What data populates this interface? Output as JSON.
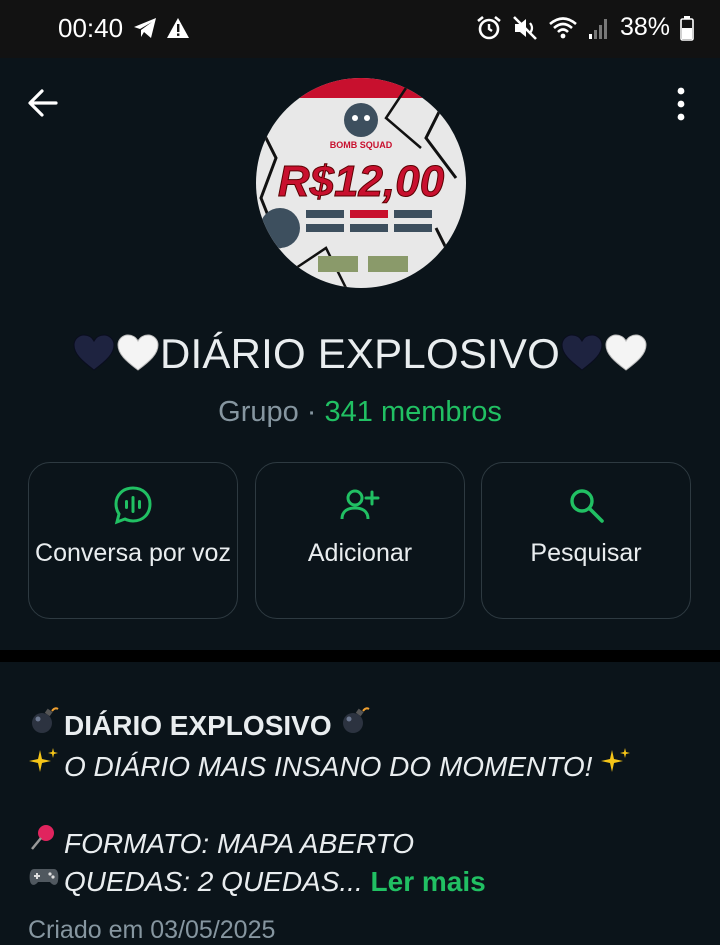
{
  "status_bar": {
    "time": "00:40",
    "battery": "38%",
    "icons": [
      "telegram-icon",
      "warning-icon",
      "alarm-icon",
      "mute-icon",
      "wifi-icon",
      "signal-icon",
      "battery-icon"
    ]
  },
  "header": {
    "back_icon": "arrow-left-icon",
    "menu_icon": "more-vertical-icon"
  },
  "avatar_text": {
    "price": "R$12,00",
    "brand": "BOMB SQUAD"
  },
  "group": {
    "name": "DIÁRIO EXPLOSIVO",
    "type_label": "Grupo",
    "separator": " · ",
    "members": "341 membros"
  },
  "actions": [
    {
      "label": "Conversa por voz",
      "icon": "voice-chat-icon"
    },
    {
      "label": "Adicionar",
      "icon": "add-person-icon"
    },
    {
      "label": "Pesquisar",
      "icon": "search-icon"
    }
  ],
  "description": {
    "line1": "DIÁRIO EXPLOSIVO",
    "line2": "O DIÁRIO MAIS INSANO DO MOMENTO!",
    "line3": "FORMATO: MAPA ABERTO",
    "line4": "QUEDAS: 2 QUEDAS...",
    "read_more": "Ler mais",
    "created": "Criado em 03/05/2025"
  },
  "colors": {
    "background": "#0b141a",
    "accent": "#21c063",
    "muted": "#8696a0"
  }
}
